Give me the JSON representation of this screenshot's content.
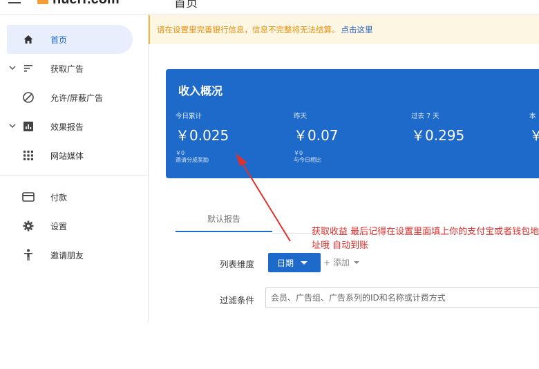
{
  "header": {
    "logo_text": "nuerr.com",
    "page_title": "首页"
  },
  "sidebar": {
    "items": [
      {
        "label": "首页",
        "icon": "home-icon",
        "active": true
      },
      {
        "label": "获取广告",
        "icon": "filter-list-icon",
        "expandable": true
      },
      {
        "label": "允许/屏蔽广告",
        "icon": "block-icon"
      },
      {
        "label": "效果报告",
        "icon": "bar-chart-icon",
        "expandable": true
      },
      {
        "label": "网站媒体",
        "icon": "grid-icon"
      },
      {
        "label": "付款",
        "icon": "credit-card-icon"
      },
      {
        "label": "设置",
        "icon": "gear-icon"
      },
      {
        "label": "邀请朋友",
        "icon": "person-icon"
      }
    ]
  },
  "notice": {
    "text": "请在设置里完善银行信息，信息不完整将无法结算。",
    "link": "点击这里"
  },
  "income": {
    "title": "收入概况",
    "stats": [
      {
        "label": "今日累计",
        "value": "￥0.025",
        "sub1": "￥0",
        "sub2": "邀请分成奖励"
      },
      {
        "label": "昨天",
        "value": "￥0.07",
        "sub1": "￥0",
        "sub2": "与今日相比"
      },
      {
        "label": "过去 7 天",
        "value": "￥0.295"
      },
      {
        "label": "本",
        "value": "￥"
      }
    ]
  },
  "tabs": [
    {
      "label": "默认报告",
      "active": true
    }
  ],
  "annotation": {
    "text": "获取收益  最后记得在设置里面填上你的支付宝或者钱包地址哦 自动到账"
  },
  "form": {
    "dimension_label": "列表维度",
    "dimension_value": "日期",
    "add_label": "+ 添加",
    "filter_label": "过滤条件",
    "filter_placeholder": "会员、广告组、广告系列的ID和名称或计费方式"
  },
  "colors": {
    "primary": "#1e6acb",
    "notice_text": "#e6900f",
    "annotation": "#e0302c"
  }
}
